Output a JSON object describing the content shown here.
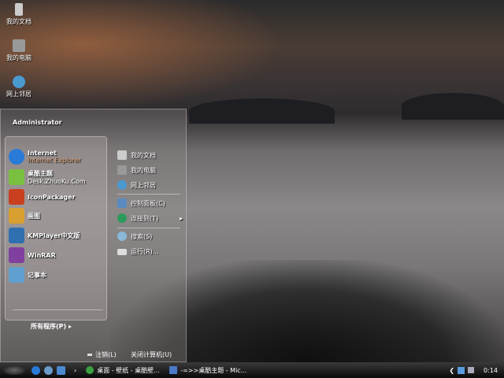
{
  "desktop": {
    "icons": [
      {
        "label": "我的文档",
        "icon": "my-documents-icon"
      },
      {
        "label": "我的电脑",
        "icon": "my-computer-icon"
      },
      {
        "label": "网上邻居",
        "icon": "network-places-icon"
      }
    ]
  },
  "start_menu": {
    "user": "Administrator",
    "pinned": [
      {
        "label": "Internet",
        "sub": "Internet Explorer",
        "icon": "internet-explorer-icon",
        "color": "#2a7ad8"
      },
      {
        "label": "桌酷主题",
        "sub": "Desk.ZhuoKu.Com",
        "icon": "zhuoku-icon",
        "color": "#7ac040"
      },
      {
        "label": "IconPackager",
        "sub": "",
        "icon": "iconpackager-icon",
        "color": "#c84020"
      },
      {
        "label": "画图",
        "sub": "",
        "icon": "paint-icon",
        "color": "#d8a030"
      },
      {
        "label": "KMPlayer中文版",
        "sub": "",
        "icon": "kmplayer-icon",
        "color": "#3070b0"
      },
      {
        "label": "WinRAR",
        "sub": "",
        "icon": "winrar-icon",
        "color": "#8040a0"
      },
      {
        "label": "记事本",
        "sub": "",
        "icon": "notepad-icon",
        "color": "#60a0d0"
      }
    ],
    "all_programs": "所有程序(P)",
    "places": [
      {
        "label": "我的文档",
        "icon": "my-documents-icon"
      },
      {
        "label": "我的电脑",
        "icon": "my-computer-icon"
      },
      {
        "label": "网上邻居",
        "icon": "network-places-icon"
      },
      {
        "label": "控制面板(C)",
        "icon": "control-panel-icon"
      },
      {
        "label": "连接到(T)",
        "icon": "connect-to-icon",
        "arrow": "▸"
      },
      {
        "label": "搜索(S)",
        "icon": "search-icon"
      },
      {
        "label": "运行(R)...",
        "icon": "run-icon"
      }
    ],
    "logoff": "注销(L)",
    "shutdown": "关闭计算机(U)"
  },
  "taskbar": {
    "tasks": [
      {
        "label": "桌面 - 壁纸 - 桌酷壁...",
        "icon": "browser-icon"
      },
      {
        "label": "-=>>桌酷主题 - Mic...",
        "icon": "word-icon"
      }
    ],
    "chevron": "›",
    "clock": "0:14"
  }
}
